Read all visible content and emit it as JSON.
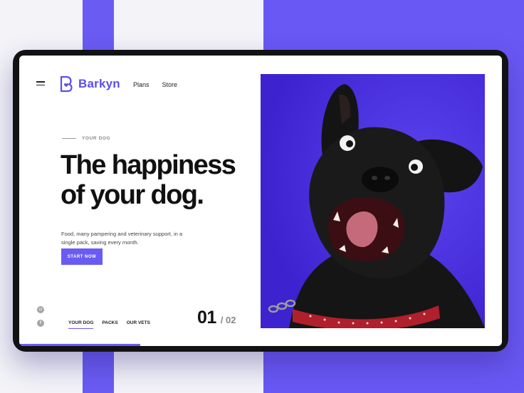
{
  "brand": {
    "name": "Barkyn",
    "accent_color": "#6a5cf2"
  },
  "nav": {
    "links": [
      "Plans",
      "Store"
    ]
  },
  "hero": {
    "eyebrow": "YOUR DOG",
    "headline_line1": "The happiness",
    "headline_line2": "of your dog.",
    "description": "Food, many pampering and veterinary support, in a single pack, saving every month.",
    "cta_label": "START NOW"
  },
  "social": {
    "icons": [
      "instagram-icon",
      "facebook-icon"
    ]
  },
  "tabs": {
    "items": [
      "YOUR DOG",
      "PACKS",
      "OUR VETS"
    ],
    "active_index": 0
  },
  "pager": {
    "current": "01",
    "total": "/ 02"
  },
  "progress": {
    "fraction": 0.25
  }
}
